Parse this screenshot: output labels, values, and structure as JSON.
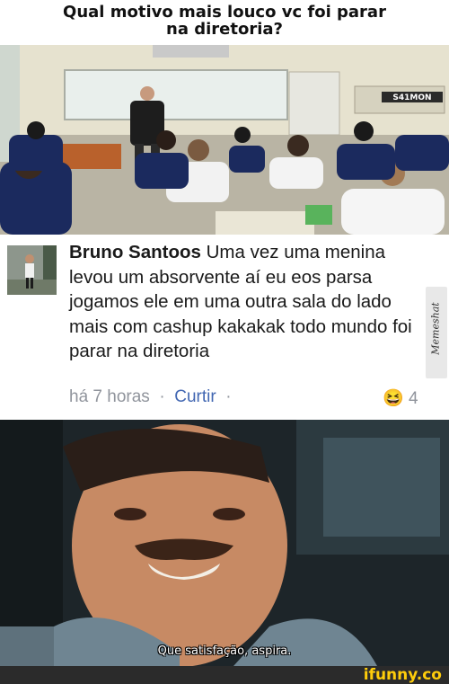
{
  "title": {
    "line1": "Qual motivo mais louco vc foi parar",
    "line2": "na diretoria?"
  },
  "classroom": {
    "sign": "S41MON"
  },
  "comment": {
    "author": "Bruno Santoos",
    "body": "Uma vez uma menina levou um absorvente aí eu eos parsa jogamos ele em uma outra sala do lado mais com cashup kakakak todo mundo foi parar na diretoria",
    "time": "há 7 horas",
    "separator": "·",
    "like": "Curtir",
    "reaction_emoji": "😆",
    "reaction_count": "4"
  },
  "watermark": "Memeshat",
  "movie": {
    "subtitle": "Que satisfação, aspira."
  },
  "footer": {
    "brand": "ifunny.co"
  }
}
